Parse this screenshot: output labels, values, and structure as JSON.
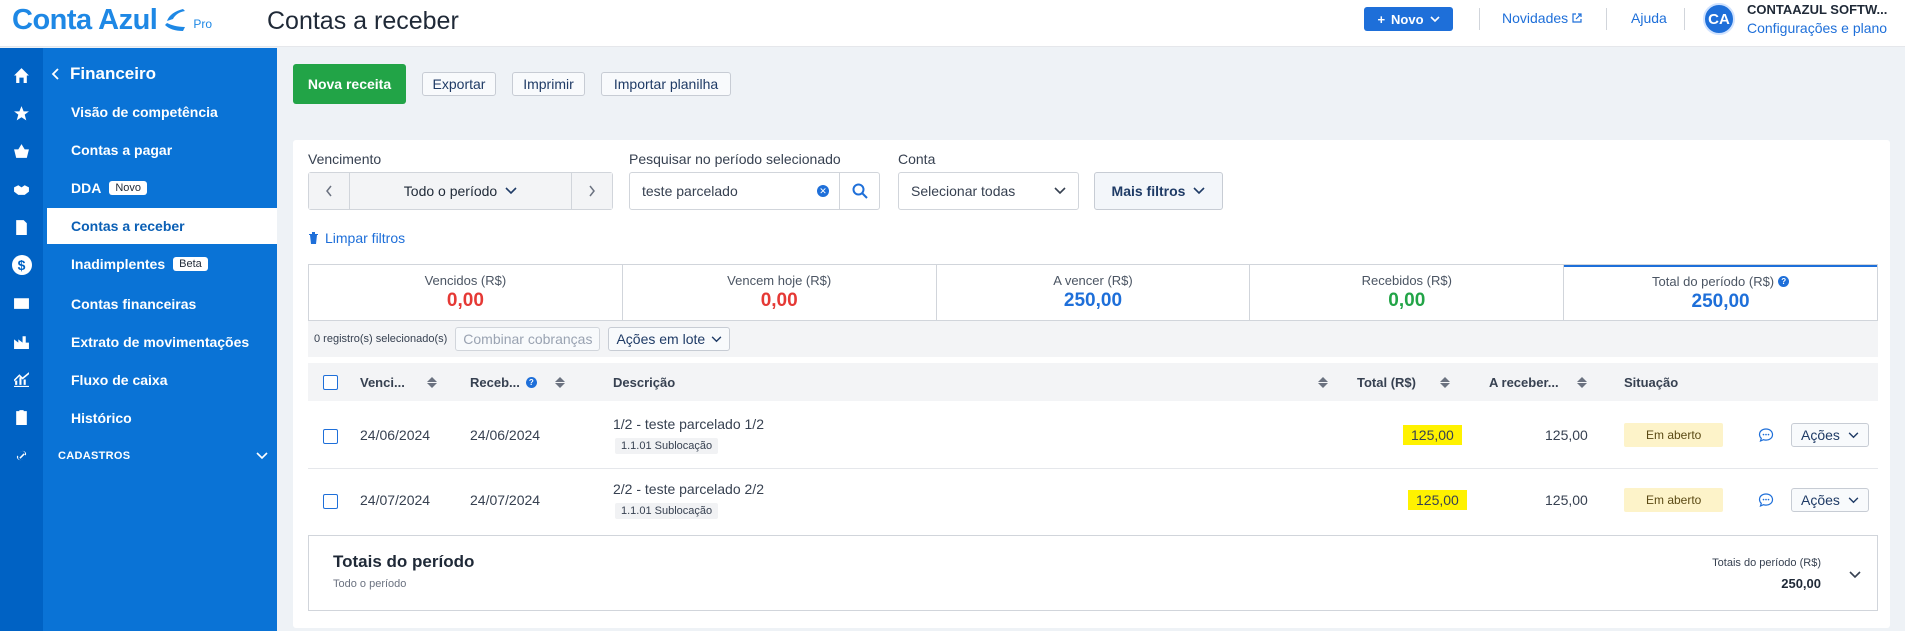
{
  "header": {
    "logo_text": "Conta Azul",
    "logo_badge": "Pro",
    "page_title": "Contas a receber",
    "new_button": "Novo",
    "news_link": "Novidades",
    "help_link": "Ajuda",
    "avatar_initials": "CA",
    "company_name": "CONTAAZUL SOFTW...",
    "settings_link": "Configurações e plano"
  },
  "sidebar": {
    "title": "Financeiro",
    "items": [
      {
        "label": "Visão de competência",
        "badge": ""
      },
      {
        "label": "Contas a pagar",
        "badge": ""
      },
      {
        "label": "DDA",
        "badge": "Novo"
      },
      {
        "label": "Contas a receber",
        "badge": ""
      },
      {
        "label": "Inadimplentes",
        "badge": "Beta"
      },
      {
        "label": "Contas financeiras",
        "badge": ""
      },
      {
        "label": "Extrato de movimentações",
        "badge": ""
      },
      {
        "label": "Fluxo de caixa",
        "badge": ""
      },
      {
        "label": "Histórico",
        "badge": ""
      }
    ],
    "section": "CADASTROS"
  },
  "rail_icons": [
    "home-icon",
    "star-icon",
    "basket-icon",
    "handshake-icon",
    "document-icon",
    "dollar-icon",
    "card-icon",
    "factory-icon",
    "chart-icon",
    "clipboard-icon",
    "link-icon"
  ],
  "toolbar": {
    "new_receipt": "Nova receita",
    "export": "Exportar",
    "print": "Imprimir",
    "import": "Importar planilha"
  },
  "filters": {
    "due_label": "Vencimento",
    "period_value": "Todo o período",
    "search_label": "Pesquisar no período selecionado",
    "search_value": "teste parcelado",
    "account_label": "Conta",
    "account_value": "Selecionar todas",
    "more_filters": "Mais filtros",
    "clear_filters": "Limpar filtros"
  },
  "stats": [
    {
      "title": "Vencidos (R$)",
      "value": "0,00",
      "color": "#e53935"
    },
    {
      "title": "Vencem hoje (R$)",
      "value": "0,00",
      "color": "#e53935"
    },
    {
      "title": "A vencer (R$)",
      "value": "250,00",
      "color": "#1e6fd9"
    },
    {
      "title": "Recebidos (R$)",
      "value": "0,00",
      "color": "#22a447"
    },
    {
      "title": "Total do período (R$)",
      "value": "250,00",
      "color": "#1e6fd9"
    }
  ],
  "bulk": {
    "selected": "0 registro(s) selecionado(s)",
    "combine": "Combinar cobranças",
    "batch": "Ações em lote"
  },
  "table": {
    "headers": {
      "due": "Venci...",
      "received": "Receb...",
      "description": "Descrição",
      "total": "Total (R$)",
      "to_receive": "A receber...",
      "status": "Situação"
    },
    "rows": [
      {
        "due": "24/06/2024",
        "received": "24/06/2024",
        "description": "1/2 - teste parcelado 1/2",
        "category": "1.1.01 Sublocação",
        "total": "125,00",
        "to_receive": "125,00",
        "status": "Em aberto",
        "actions": "Ações"
      },
      {
        "due": "24/07/2024",
        "received": "24/07/2024",
        "description": "2/2 - teste parcelado 2/2",
        "category": "1.1.01 Sublocação",
        "total": "125,00",
        "to_receive": "125,00",
        "status": "Em aberto",
        "actions": "Ações"
      }
    ]
  },
  "totals": {
    "title": "Totais do período",
    "subtitle": "Todo o período",
    "label": "Totais do período (R$)",
    "value": "250,00"
  }
}
